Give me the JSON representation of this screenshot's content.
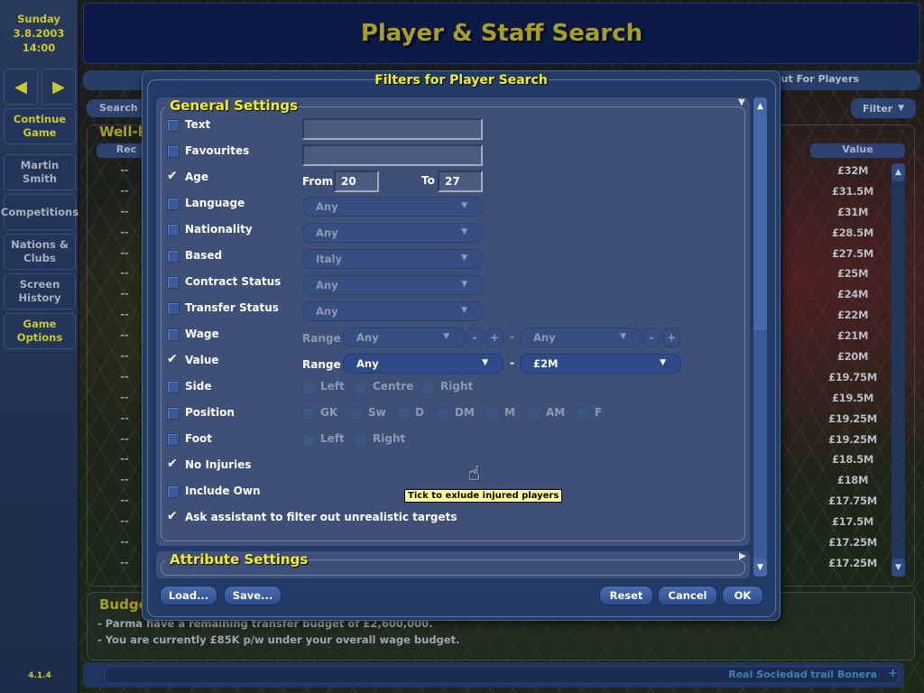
{
  "sidebar": {
    "day": "Sunday",
    "date": "3.8.2003",
    "time": "14:00",
    "back_icon": "left-arrow-icon",
    "forward_icon": "right-arrow-icon",
    "buttons": [
      {
        "label": "Continue Game"
      },
      {
        "label": "Martin Smith"
      },
      {
        "label": "Competitions"
      },
      {
        "label": "Nations & Clubs"
      },
      {
        "label": "Screen History"
      },
      {
        "label": "Game Options"
      }
    ],
    "version": "4.1.4"
  },
  "header": {
    "title": "Player & Staff Search"
  },
  "subbar": {
    "text": "out For Players"
  },
  "search_tab": "Search",
  "filter_button": "Filter",
  "list": {
    "title": "Well-k",
    "columns": {
      "rec": "Rec",
      "value": "Value"
    },
    "rows": [
      {
        "rec": "--",
        "value": "£32M"
      },
      {
        "rec": "--",
        "value": "£31.5M"
      },
      {
        "rec": "--",
        "value": "£31M"
      },
      {
        "rec": "--",
        "value": "£28.5M"
      },
      {
        "rec": "--",
        "value": "£27.5M"
      },
      {
        "rec": "--",
        "value": "£25M"
      },
      {
        "rec": "--",
        "value": "£24M"
      },
      {
        "rec": "--",
        "value": "£22M"
      },
      {
        "rec": "--",
        "value": "£21M"
      },
      {
        "rec": "--",
        "value": "£20M"
      },
      {
        "rec": "--",
        "value": "£19.75M"
      },
      {
        "rec": "--",
        "value": "£19.5M"
      },
      {
        "rec": "--",
        "value": "£19.25M"
      },
      {
        "rec": "--",
        "value": "£19.25M"
      },
      {
        "rec": "--",
        "value": "£18.5M"
      },
      {
        "rec": "--",
        "value": "£18M"
      },
      {
        "rec": "--",
        "value": "£17.75M"
      },
      {
        "rec": "--",
        "value": "£17.5M"
      },
      {
        "rec": "--",
        "value": "£17.25M"
      },
      {
        "rec": "--",
        "value": "£17.25M"
      }
    ]
  },
  "budget": {
    "title": "Budge",
    "lines": [
      "- Parma have a remaining transfer budget of £2,600,000.",
      "- You are currently £85K p/w under your overall wage budget."
    ]
  },
  "news": {
    "text": "Real Sociedad trail Bonera",
    "plus": "+"
  },
  "dialog": {
    "title": "Filters for Player Search",
    "general_title": "General Settings",
    "attribute_title": "Attribute Settings",
    "filters": {
      "text": {
        "label": "Text",
        "checked": false,
        "value": ""
      },
      "favourites": {
        "label": "Favourites",
        "checked": false,
        "value": ""
      },
      "age": {
        "label": "Age",
        "checked": true,
        "from_label": "From",
        "from": "20",
        "to_label": "To",
        "to": "27"
      },
      "language": {
        "label": "Language",
        "checked": false,
        "value": "Any"
      },
      "nationality": {
        "label": "Nationality",
        "checked": false,
        "value": "Any"
      },
      "based": {
        "label": "Based",
        "checked": false,
        "value": "Italy"
      },
      "contract_status": {
        "label": "Contract Status",
        "checked": false,
        "value": "Any"
      },
      "transfer_status": {
        "label": "Transfer Status",
        "checked": false,
        "value": "Any"
      },
      "wage": {
        "label": "Wage",
        "checked": false,
        "range_label": "Range",
        "min": "Any",
        "max": "Any",
        "minus": "-",
        "plus": "+",
        "dash": "-"
      },
      "value": {
        "label": "Value",
        "checked": true,
        "range_label": "Range",
        "min": "Any",
        "max": "£2M",
        "dash": "-"
      },
      "side": {
        "label": "Side",
        "checked": false,
        "options": [
          "Left",
          "Centre",
          "Right"
        ]
      },
      "position": {
        "label": "Position",
        "checked": false,
        "options": [
          "GK",
          "Sw",
          "D",
          "DM",
          "M",
          "AM",
          "F"
        ]
      },
      "foot": {
        "label": "Foot",
        "checked": false,
        "options": [
          "Left",
          "Right"
        ]
      },
      "no_injuries": {
        "label": "No Injuries",
        "checked": true
      },
      "include_own": {
        "label": "Include Own",
        "checked": false
      },
      "assistant": {
        "label": "Ask assistant to filter out unrealistic targets",
        "checked": true
      }
    },
    "tooltip": "Tick to exlude injured players",
    "buttons": {
      "load": "Load...",
      "save": "Save...",
      "reset": "Reset",
      "cancel": "Cancel",
      "ok": "OK"
    }
  }
}
